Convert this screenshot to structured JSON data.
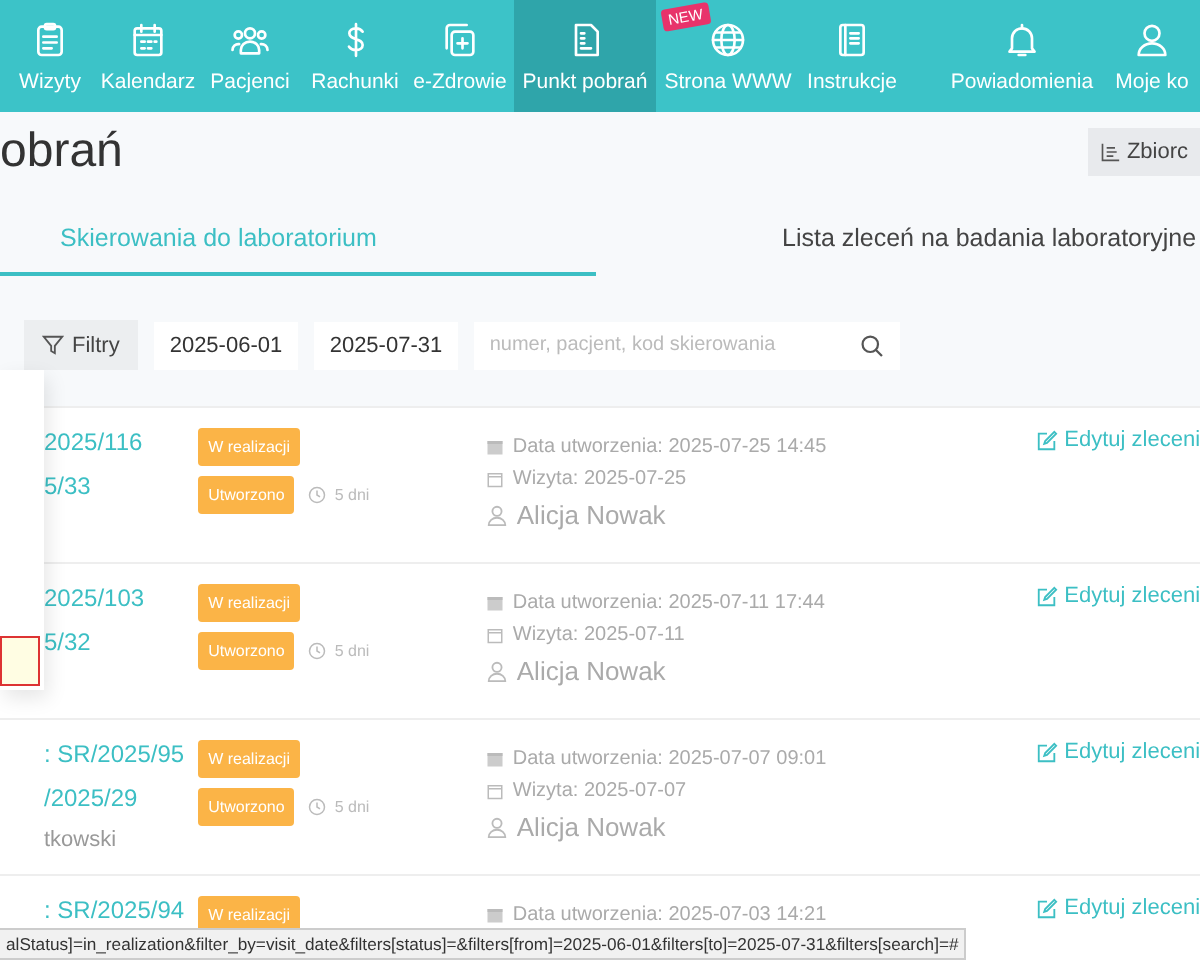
{
  "nav": {
    "items": [
      {
        "label": "Wizyty",
        "selected": false
      },
      {
        "label": "Kalendarz",
        "selected": false
      },
      {
        "label": "Pacjenci",
        "selected": false
      },
      {
        "label": "Rachunki",
        "selected": false
      },
      {
        "label": "e-Zdrowie",
        "selected": false
      },
      {
        "label": "Punkt pobrań",
        "selected": true
      },
      {
        "label": "Strona WWW",
        "selected": false,
        "badge": "NEW"
      },
      {
        "label": "Instrukcje",
        "selected": false
      },
      {
        "label": "Powiadomienia",
        "selected": false
      },
      {
        "label": "Moje ko",
        "selected": false
      }
    ]
  },
  "page": {
    "title": "obrań",
    "summary_button": "Zbiorc"
  },
  "tabs": [
    {
      "label": "Skierowania do laboratorium",
      "selected": true
    },
    {
      "label": "Lista zleceń na badania laboratoryjne",
      "selected": false
    }
  ],
  "filters": {
    "button": "Filtry",
    "date_from": "2025-06-01",
    "date_to": "2025-07-31",
    "search": {
      "placeholder": "numer, pacjent, kod skierowania"
    }
  },
  "dropdown": {
    "field": {
      "highlighted": true
    }
  },
  "orders": [
    {
      "lines": [
        {
          "kind": "number",
          "text": "2025/116"
        },
        {
          "kind": "number",
          "text": "5/33"
        }
      ],
      "statuses": [
        {
          "label": "W realizacji"
        },
        {
          "label": "Utworzono",
          "age": "5 dni"
        }
      ],
      "created": "Data utworzenia: 2025-07-25 14:45",
      "visit": "Wizyta: 2025-07-25",
      "patient": "Alicja Nowak",
      "action": "Edytuj zleceni"
    },
    {
      "lines": [
        {
          "kind": "number",
          "text": "2025/103"
        },
        {
          "kind": "number",
          "text": "5/32"
        }
      ],
      "statuses": [
        {
          "label": "W realizacji"
        },
        {
          "label": "Utworzono",
          "age": "5 dni"
        }
      ],
      "created": "Data utworzenia: 2025-07-11 17:44",
      "visit": "Wizyta: 2025-07-11",
      "patient": "Alicja Nowak",
      "action": "Edytuj zleceni"
    },
    {
      "lines": [
        {
          "kind": "number",
          "text": ": SR/2025/95"
        },
        {
          "kind": "number",
          "text": "/2025/29"
        },
        {
          "kind": "name",
          "text": "tkowski"
        }
      ],
      "statuses": [
        {
          "label": "W realizacji"
        },
        {
          "label": "Utworzono",
          "age": "5 dni"
        }
      ],
      "created": "Data utworzenia: 2025-07-07 09:01",
      "visit": "Wizyta: 2025-07-07",
      "patient": "Alicja Nowak",
      "action": "Edytuj zleceni"
    },
    {
      "lines": [
        {
          "kind": "number",
          "text": ": SR/2025/94"
        }
      ],
      "statuses": [
        {
          "label": "W realizacji"
        }
      ],
      "created": "Data utworzenia: 2025-07-03 14:21",
      "action": "Edytuj zleceni"
    }
  ],
  "status_bar": "alStatus]=in_realization&filter_by=visit_date&filters[status]=&filters[from]=2025-06-01&filters[to]=2025-07-31&filters[search]=#"
}
